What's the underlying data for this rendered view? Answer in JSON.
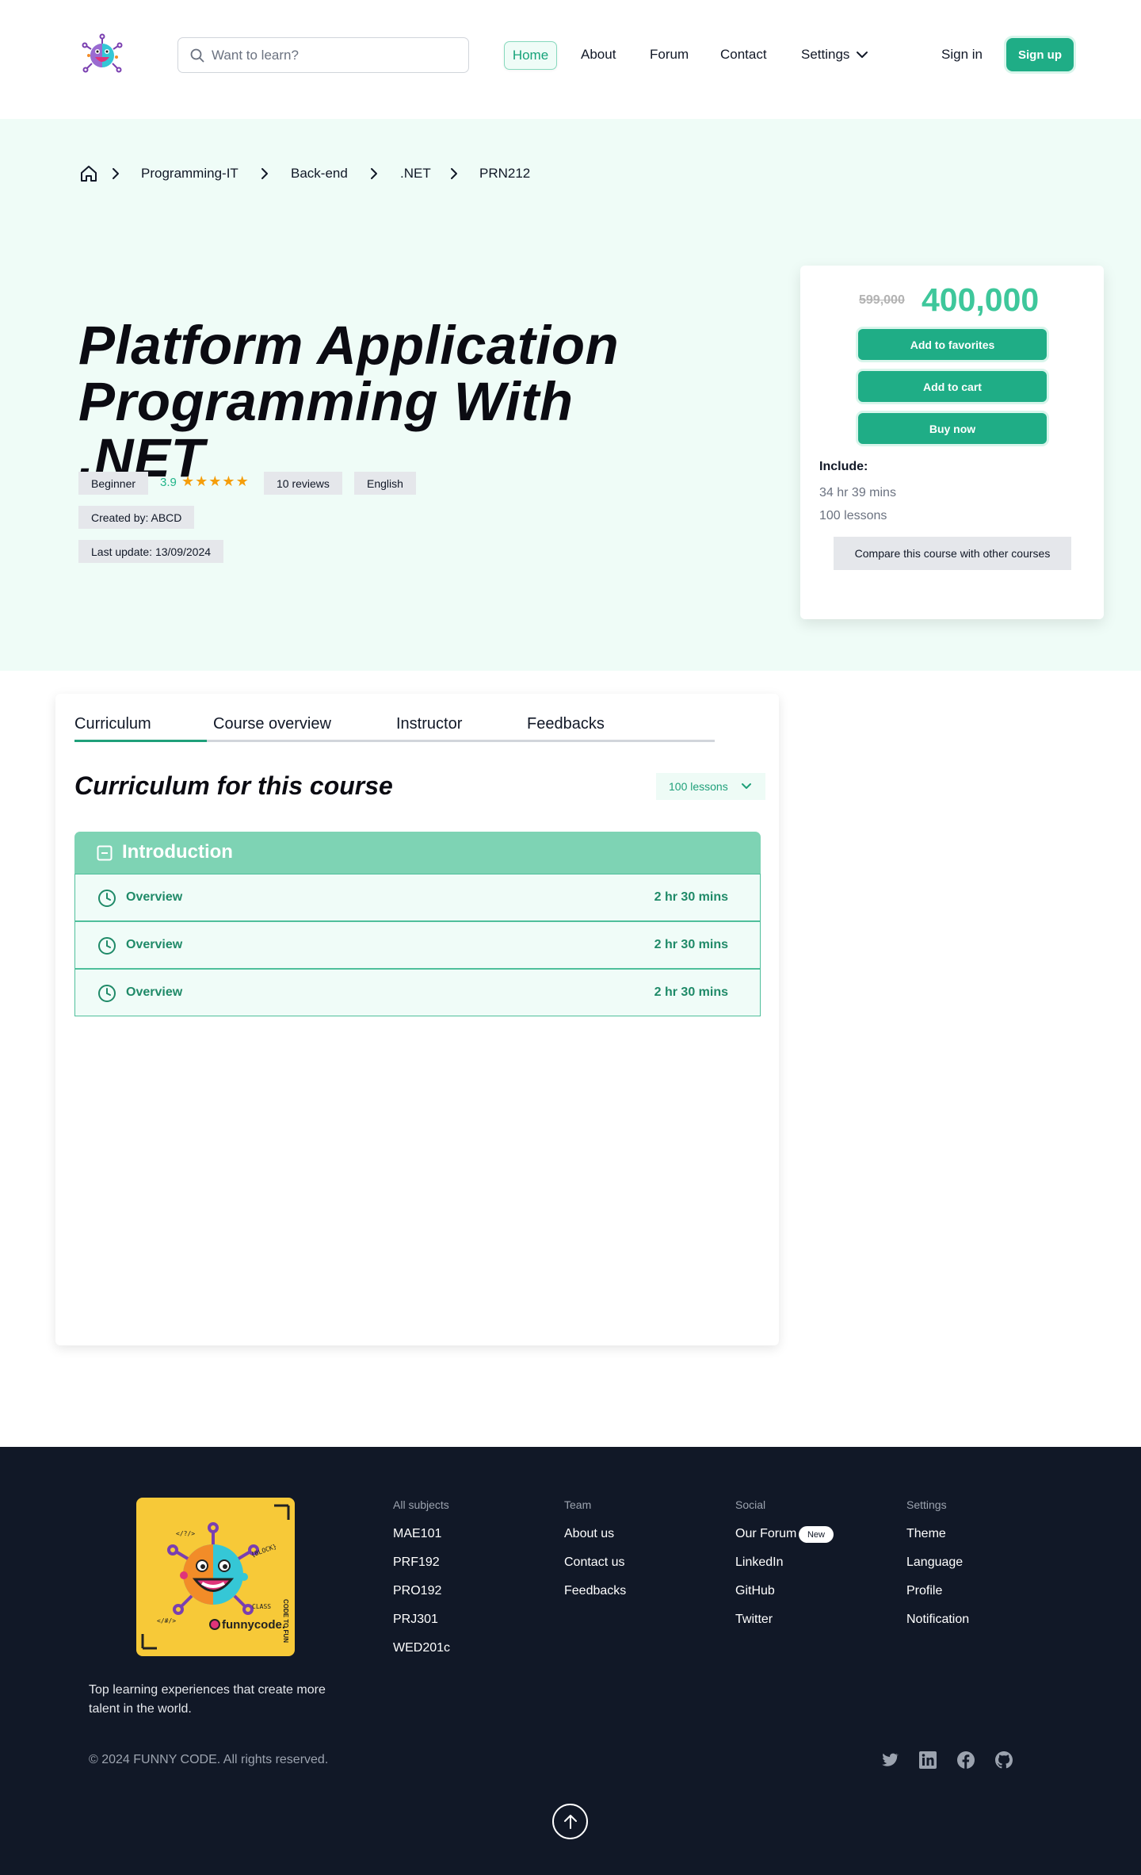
{
  "header": {
    "search_placeholder": "Want to learn?",
    "nav": {
      "home": "Home",
      "about": "About",
      "forum": "Forum",
      "contact": "Contact",
      "settings": "Settings"
    },
    "sign_in": "Sign in",
    "sign_up": "Sign up"
  },
  "breadcrumb": [
    "Programming-IT",
    "Back-end",
    ".NET",
    "PRN212"
  ],
  "course": {
    "title_line1": "Platform Application",
    "title_line2": "Programming With .NET",
    "level": "Beginner",
    "rating": "3.9",
    "rating_stars": 5,
    "reviews": "10 reviews",
    "language": "English",
    "created_by": "Created by: ABCD",
    "last_update": "Last update: 13/09/2024"
  },
  "pricing": {
    "old_price": "599,000",
    "price": "400,000",
    "add_to_favorites": "Add to favorites",
    "add_to_cart": "Add to cart",
    "buy_now": "Buy now",
    "include_label": "Include:",
    "duration": "34 hr 39 mins",
    "lessons": "100 lessons",
    "compare": "Compare this course with other courses"
  },
  "tabs": [
    "Curriculum",
    "Course overview",
    "Instructor",
    "Feedbacks"
  ],
  "curriculum": {
    "title": "Curriculum for this course",
    "lessons_dropdown": "100 lessons",
    "section_title": "Introduction",
    "items": [
      {
        "name": "Overview",
        "duration": "2 hr 30 mins"
      },
      {
        "name": "Overview",
        "duration": "2 hr 30 mins"
      },
      {
        "name": "Overview",
        "duration": "2 hr 30 mins"
      }
    ]
  },
  "footer": {
    "tagline": "Top learning experiences that create more talent in the world.",
    "columns": [
      {
        "heading": "All subjects",
        "links": [
          "MAE101",
          "PRF192",
          "PRO192",
          "PRJ301",
          "WED201c"
        ]
      },
      {
        "heading": "Team",
        "links": [
          "About us",
          "Contact us",
          "Feedbacks"
        ]
      },
      {
        "heading": "Social",
        "links": [
          "Our Forum",
          "LinkedIn",
          "GitHub",
          "Twitter"
        ]
      },
      {
        "heading": "Settings",
        "links": [
          "Theme",
          "Language",
          "Profile",
          "Notification"
        ]
      }
    ],
    "new_badge": "New",
    "copyright": "© 2024 FUNNY CODE. All rights reserved.",
    "logo_text": {
      "brand": "funnycode.",
      "t1": "</?/>",
      "t2": "{BLOCK}",
      "t3": "CLASS",
      "t4": "</#/>",
      "t5": "CODE TO FUN"
    }
  },
  "colors": {
    "accent": "#1fad86",
    "hero_bg": "#effcf7",
    "footer_bg": "#111827",
    "section_header": "#7ed3b4"
  },
  "icons": [
    "logo",
    "search-icon",
    "chevron-down-icon",
    "home-icon",
    "chevron-right-icon",
    "star-icon",
    "minus-square-icon",
    "clock-icon",
    "twitter-icon",
    "linkedin-icon",
    "facebook-icon",
    "github-icon",
    "arrow-up-icon"
  ]
}
